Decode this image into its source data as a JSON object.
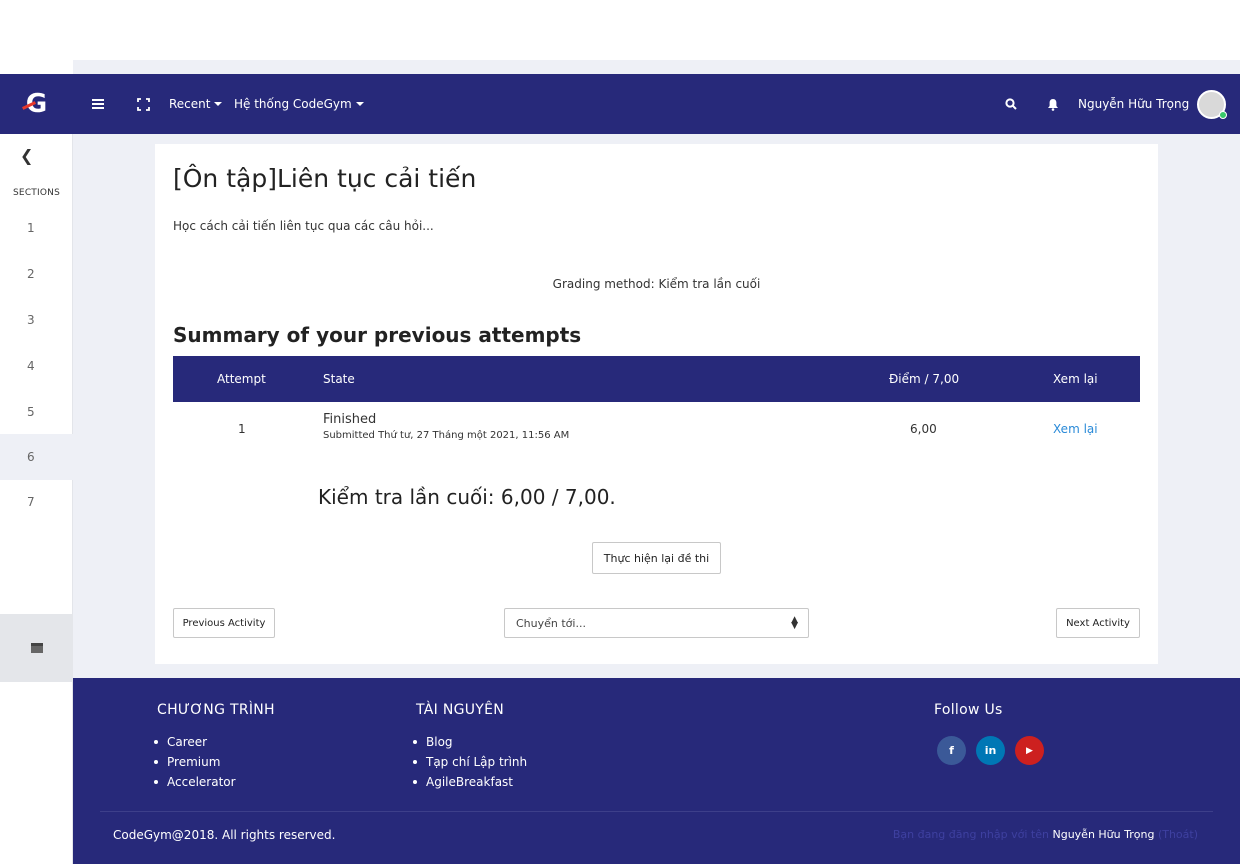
{
  "navbar": {
    "recent_label": "Recent",
    "system_label": "Hệ thống CodeGym",
    "user_name": "Nguyễn Hữu Trọng"
  },
  "sidebar": {
    "sections_label": "SECTIONS",
    "items": [
      {
        "label": "1"
      },
      {
        "label": "2"
      },
      {
        "label": "3"
      },
      {
        "label": "4"
      },
      {
        "label": "5"
      },
      {
        "label": "6"
      },
      {
        "label": "7"
      }
    ],
    "active_item": "6"
  },
  "main": {
    "title": "[Ôn tập]Liên tục cải tiến",
    "intro": "Học cách cải tiến liên tục qua các câu hỏi...",
    "grading_method": "Grading method: Kiểm tra lần cuối",
    "summary_heading": "Summary of your previous attempts",
    "table": {
      "headers": [
        "Attempt",
        "State",
        "Điểm / 7,00",
        "Xem lại"
      ],
      "rows": [
        {
          "attempt": "1",
          "state": "Finished",
          "submitted": "Submitted Thứ tư, 27 Tháng một 2021, 11:56 AM",
          "score": "6,00",
          "review": "Xem lại"
        }
      ]
    },
    "final_grade": "Kiểm tra lần cuối: 6,00 / 7,00.",
    "retake_button": "Thực hiện lại đề thi",
    "prev_button": "Previous Activity",
    "jump_select": "Chuyển tới...",
    "next_button": "Next Activity"
  },
  "footer": {
    "col1_heading": "CHƯƠNG TRÌNH",
    "col1_items": [
      "Career",
      "Premium",
      "Accelerator"
    ],
    "col2_heading": "TÀI NGUYÊN",
    "col2_items": [
      "Blog",
      "Tạp chí Lập trình",
      "AgileBreakfast"
    ],
    "follow_heading": "Follow Us",
    "social": [
      {
        "name": "facebook",
        "glyph": "f",
        "color": "#3b5998"
      },
      {
        "name": "linkedin",
        "glyph": "in",
        "color": "#0077b5"
      },
      {
        "name": "youtube",
        "glyph": "▶",
        "color": "#cd201f"
      }
    ],
    "copyright": "CodeGym@2018. All rights reserved.",
    "logged_in_prefix": "Bạn đang đăng nhập với tên",
    "logged_in_user": "Nguyễn Hữu Trọng",
    "logout": "(Thoát)"
  },
  "colors": {
    "brand": "#27297a",
    "page_bg": "#eef0f6",
    "link": "#2a8ad8"
  }
}
